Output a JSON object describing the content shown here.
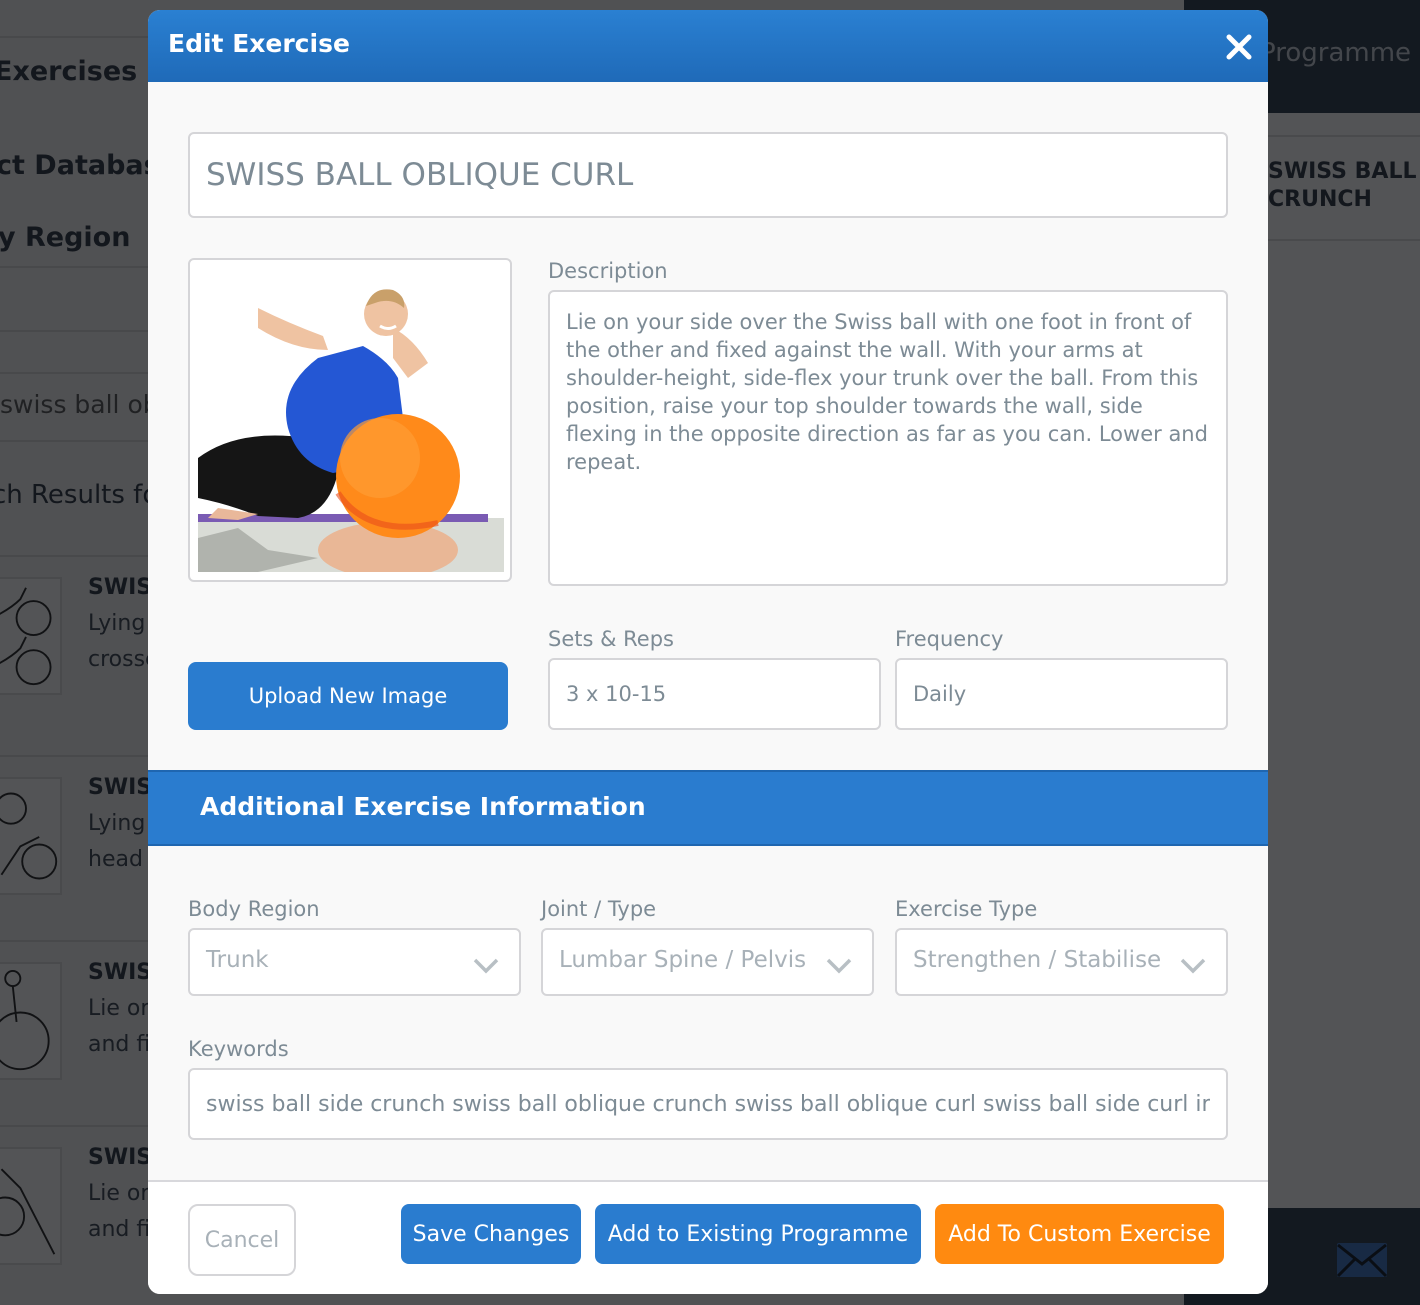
{
  "background": {
    "left_panel": {
      "heading_exercises": "Exercises",
      "heading_database": "ct Database",
      "heading_region": "y Region",
      "search_value": "swiss ball obl",
      "results_heading": "ch Results fo",
      "results": [
        {
          "title": "SWISS",
          "line1": "Lying",
          "line2": "crosse"
        },
        {
          "title": "SWISS",
          "line1": "Lying",
          "line2": "head"
        },
        {
          "title": "SWISS",
          "line1": "Lie or",
          "line2": "and fi"
        },
        {
          "title": "SWISS",
          "line1": "Lie or",
          "line2": "and fi"
        }
      ]
    },
    "right_panel": {
      "header_title": "Programme C",
      "item_line1": "SWISS BALL SI",
      "item_line2": "CRUNCH"
    }
  },
  "modal": {
    "title": "Edit Exercise",
    "exercise_name": "SWISS BALL OBLIQUE CURL",
    "image_alt": "Woman performing a side crunch over an orange Swiss ball",
    "description_label": "Description",
    "description": "Lie on your side over the Swiss ball with one foot in front of the other and fixed against the wall. With your arms at shoulder-height, side-flex your trunk over the ball. From this position, raise your top shoulder towards the wall, side flexing in the opposite direction as far as you can. Lower and repeat.",
    "upload_label": "Upload New Image",
    "sets_reps_label": "Sets & Reps",
    "sets_reps_value": "3 x 10-15",
    "frequency_label": "Frequency",
    "frequency_value": "Daily",
    "additional_section_title": "Additional Exercise Information",
    "body_region_label": "Body Region",
    "body_region_value": "Trunk",
    "joint_type_label": "Joint / Type",
    "joint_type_value": "Lumbar Spine / Pelvis",
    "exercise_type_label": "Exercise Type",
    "exercise_type_value": "Strengthen / Stabilise",
    "keywords_label": "Keywords",
    "keywords_value": "swiss ball side crunch swiss ball oblique crunch swiss ball oblique curl swiss ball side curl internal oblique",
    "footer": {
      "cancel": "Cancel",
      "save": "Save Changes",
      "add_existing": "Add to Existing Programme",
      "add_custom": "Add To Custom Exercise"
    }
  },
  "colors": {
    "primary_blue": "#2a7ccf",
    "accent_orange": "#ff8a10"
  }
}
